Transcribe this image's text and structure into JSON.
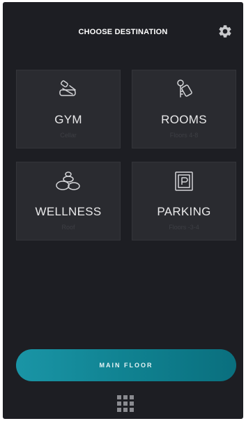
{
  "header": {
    "title": "CHOOSE DESTINATION",
    "settings_icon": "gear-icon"
  },
  "destinations": [
    {
      "label": "GYM",
      "sub": "Cellar",
      "icon": "dumbbell-icon"
    },
    {
      "label": "ROOMS",
      "sub": "Floors 4-8",
      "icon": "room-key-icon"
    },
    {
      "label": "WELLNESS",
      "sub": "Roof",
      "icon": "spa-stones-icon"
    },
    {
      "label": "PARKING",
      "sub": "Floors -3-4",
      "icon": "parking-icon"
    }
  ],
  "footer": {
    "main_floor_label": "MAIN FLOOR",
    "main_floor_color": "#1a95a6",
    "grid_icon": "grid-menu-icon"
  },
  "colors": {
    "background": "#1d1e23",
    "tile": "#2a2b30",
    "accent": "#1a95a6"
  }
}
